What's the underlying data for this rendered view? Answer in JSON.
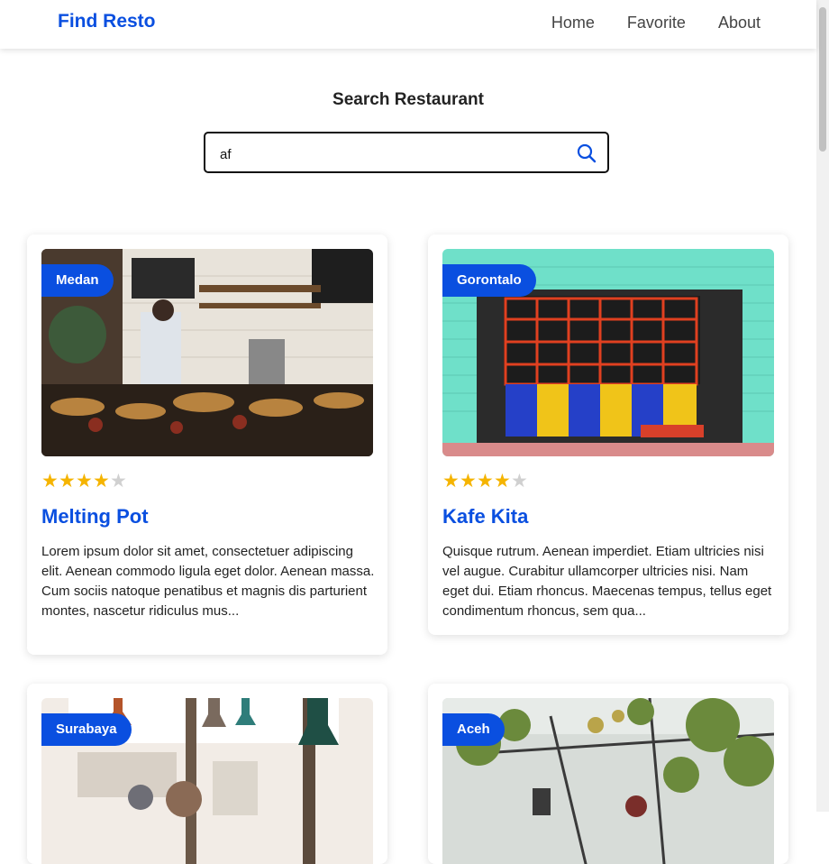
{
  "navbar": {
    "brand": "Find Resto",
    "links": [
      "Home",
      "Favorite",
      "About"
    ]
  },
  "search": {
    "title": "Search Restaurant",
    "value": "af",
    "icon": "search-icon"
  },
  "colors": {
    "accent": "#0a4fe0",
    "star": "#f5b400",
    "star_empty": "#d0d0d0"
  },
  "restaurants": [
    {
      "city": "Medan",
      "name": "Melting Pot",
      "rating": 4,
      "description": "Lorem ipsum dolor sit amet, consectetuer adipiscing elit. Aenean commodo ligula eget dolor. Aenean massa. Cum sociis natoque penatibus et magnis dis parturient montes, nascetur ridiculus mus..."
    },
    {
      "city": "Gorontalo",
      "name": "Kafe Kita",
      "rating": 4,
      "description": "Quisque rutrum. Aenean imperdiet. Etiam ultricies nisi vel augue. Curabitur ullamcorper ultricies nisi. Nam eget dui. Etiam rhoncus. Maecenas tempus, tellus eget condimentum rhoncus, sem qua..."
    },
    {
      "city": "Surabaya"
    },
    {
      "city": "Aceh"
    }
  ]
}
